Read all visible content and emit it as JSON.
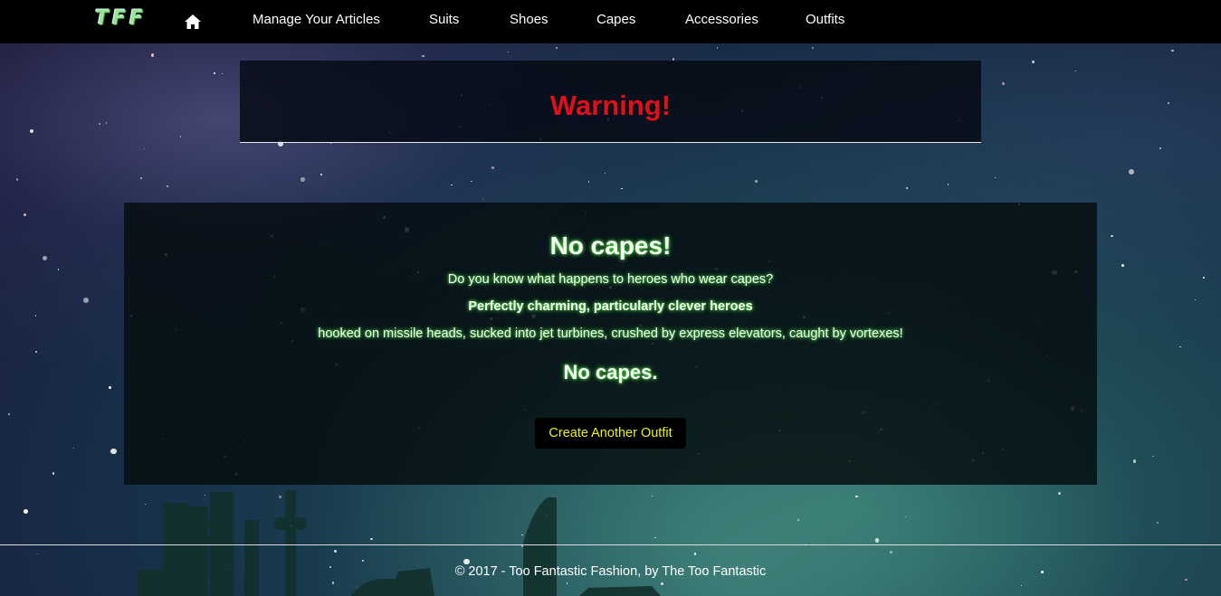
{
  "navbar": {
    "brand": "TFF",
    "home_icon": "home-icon",
    "items": [
      {
        "label": "Manage Your Articles"
      },
      {
        "label": "Suits"
      },
      {
        "label": "Shoes"
      },
      {
        "label": "Capes"
      },
      {
        "label": "Accessories"
      },
      {
        "label": "Outfits"
      }
    ]
  },
  "warning": {
    "title": "Warning!",
    "title_color": "#e0101a"
  },
  "main": {
    "title": "No capes!",
    "question": "Do you know what happens to heroes who wear capes?",
    "emphasis": "Perfectly charming, particularly clever heroes",
    "fates": "hooked on missile heads, sucked into jet turbines, crushed by express elevators, caught by vortexes!",
    "conclusion": "No capes.",
    "button_label": "Create Another Outfit",
    "button_text_color": "#e8f21c",
    "glow_color": "#5bdc4b"
  },
  "footer": {
    "text": "© 2017 - Too Fantastic Fashion, by The Too Fantastic"
  }
}
